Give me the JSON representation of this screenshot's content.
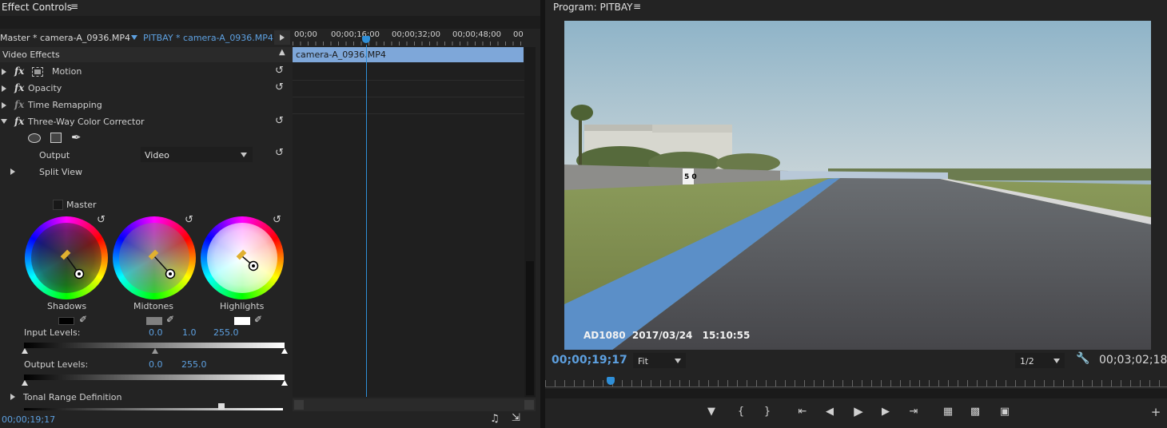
{
  "effect_controls": {
    "title": "Effect Controls",
    "master_clip": "Master * camera-A_0936.MP4",
    "sequence_clip": "PITBAY * camera-A_0936.MP4",
    "section_title": "Video Effects",
    "timecodes": [
      "00;00",
      "00;00;16;00",
      "00;00;32;00",
      "00;00;48;00",
      "00"
    ],
    "clip_label": "camera-A_0936.MP4",
    "effects": [
      {
        "label": "Motion"
      },
      {
        "label": "Opacity"
      },
      {
        "label": "Time Remapping"
      },
      {
        "label": "Three-Way Color Corrector"
      }
    ],
    "output_label": "Output",
    "output_value": "Video",
    "split_view_label": "Split View",
    "master_label": "Master",
    "wheels": [
      {
        "label": "Shadows",
        "swatch": "#000000"
      },
      {
        "label": "Midtones",
        "swatch": "#808080"
      },
      {
        "label": "Highlights",
        "swatch": "#ffffff"
      }
    ],
    "input_levels_label": "Input Levels:",
    "input_levels": [
      "0.0",
      "1.0",
      "255.0"
    ],
    "output_levels_label": "Output Levels:",
    "output_levels": [
      "0.0",
      "255.0"
    ],
    "tonal_range_label": "Tonal Range Definition",
    "current_time": "00;00;19;17"
  },
  "program": {
    "title": "Program: PITBAY",
    "current_time": "00;00;19;17",
    "fit_label": "Fit",
    "resolution": "1/2",
    "duration": "00;03;02;18",
    "video_overlay": {
      "camera": "AD1080",
      "date": "2017/03/24",
      "time": "15:10:55",
      "sign": "5 0"
    }
  },
  "colors": {
    "panel_bg": "#232323",
    "accent_blue": "#5da0e0",
    "clip_bar": "#7ea7d9",
    "playhead": "#2f8fd8"
  }
}
